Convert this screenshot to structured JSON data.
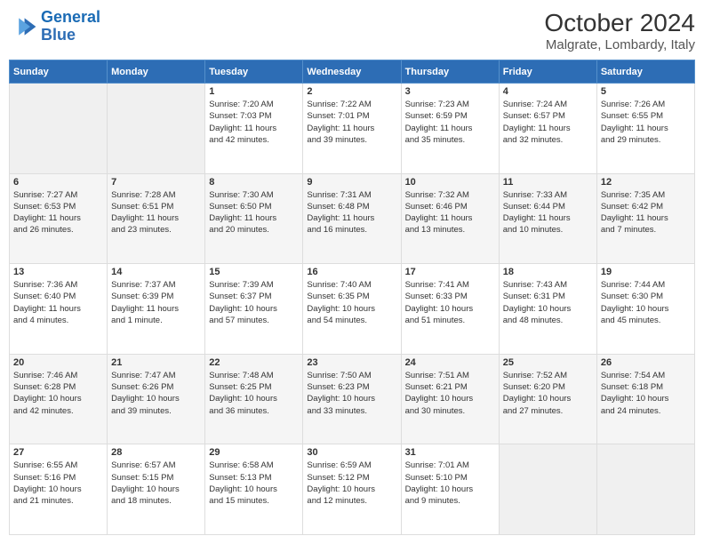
{
  "logo": {
    "line1": "General",
    "line2": "Blue"
  },
  "title": "October 2024",
  "subtitle": "Malgrate, Lombardy, Italy",
  "days_of_week": [
    "Sunday",
    "Monday",
    "Tuesday",
    "Wednesday",
    "Thursday",
    "Friday",
    "Saturday"
  ],
  "weeks": [
    [
      {
        "day": "",
        "info": ""
      },
      {
        "day": "",
        "info": ""
      },
      {
        "day": "1",
        "info": "Sunrise: 7:20 AM\nSunset: 7:03 PM\nDaylight: 11 hours\nand 42 minutes."
      },
      {
        "day": "2",
        "info": "Sunrise: 7:22 AM\nSunset: 7:01 PM\nDaylight: 11 hours\nand 39 minutes."
      },
      {
        "day": "3",
        "info": "Sunrise: 7:23 AM\nSunset: 6:59 PM\nDaylight: 11 hours\nand 35 minutes."
      },
      {
        "day": "4",
        "info": "Sunrise: 7:24 AM\nSunset: 6:57 PM\nDaylight: 11 hours\nand 32 minutes."
      },
      {
        "day": "5",
        "info": "Sunrise: 7:26 AM\nSunset: 6:55 PM\nDaylight: 11 hours\nand 29 minutes."
      }
    ],
    [
      {
        "day": "6",
        "info": "Sunrise: 7:27 AM\nSunset: 6:53 PM\nDaylight: 11 hours\nand 26 minutes."
      },
      {
        "day": "7",
        "info": "Sunrise: 7:28 AM\nSunset: 6:51 PM\nDaylight: 11 hours\nand 23 minutes."
      },
      {
        "day": "8",
        "info": "Sunrise: 7:30 AM\nSunset: 6:50 PM\nDaylight: 11 hours\nand 20 minutes."
      },
      {
        "day": "9",
        "info": "Sunrise: 7:31 AM\nSunset: 6:48 PM\nDaylight: 11 hours\nand 16 minutes."
      },
      {
        "day": "10",
        "info": "Sunrise: 7:32 AM\nSunset: 6:46 PM\nDaylight: 11 hours\nand 13 minutes."
      },
      {
        "day": "11",
        "info": "Sunrise: 7:33 AM\nSunset: 6:44 PM\nDaylight: 11 hours\nand 10 minutes."
      },
      {
        "day": "12",
        "info": "Sunrise: 7:35 AM\nSunset: 6:42 PM\nDaylight: 11 hours\nand 7 minutes."
      }
    ],
    [
      {
        "day": "13",
        "info": "Sunrise: 7:36 AM\nSunset: 6:40 PM\nDaylight: 11 hours\nand 4 minutes."
      },
      {
        "day": "14",
        "info": "Sunrise: 7:37 AM\nSunset: 6:39 PM\nDaylight: 11 hours\nand 1 minute."
      },
      {
        "day": "15",
        "info": "Sunrise: 7:39 AM\nSunset: 6:37 PM\nDaylight: 10 hours\nand 57 minutes."
      },
      {
        "day": "16",
        "info": "Sunrise: 7:40 AM\nSunset: 6:35 PM\nDaylight: 10 hours\nand 54 minutes."
      },
      {
        "day": "17",
        "info": "Sunrise: 7:41 AM\nSunset: 6:33 PM\nDaylight: 10 hours\nand 51 minutes."
      },
      {
        "day": "18",
        "info": "Sunrise: 7:43 AM\nSunset: 6:31 PM\nDaylight: 10 hours\nand 48 minutes."
      },
      {
        "day": "19",
        "info": "Sunrise: 7:44 AM\nSunset: 6:30 PM\nDaylight: 10 hours\nand 45 minutes."
      }
    ],
    [
      {
        "day": "20",
        "info": "Sunrise: 7:46 AM\nSunset: 6:28 PM\nDaylight: 10 hours\nand 42 minutes."
      },
      {
        "day": "21",
        "info": "Sunrise: 7:47 AM\nSunset: 6:26 PM\nDaylight: 10 hours\nand 39 minutes."
      },
      {
        "day": "22",
        "info": "Sunrise: 7:48 AM\nSunset: 6:25 PM\nDaylight: 10 hours\nand 36 minutes."
      },
      {
        "day": "23",
        "info": "Sunrise: 7:50 AM\nSunset: 6:23 PM\nDaylight: 10 hours\nand 33 minutes."
      },
      {
        "day": "24",
        "info": "Sunrise: 7:51 AM\nSunset: 6:21 PM\nDaylight: 10 hours\nand 30 minutes."
      },
      {
        "day": "25",
        "info": "Sunrise: 7:52 AM\nSunset: 6:20 PM\nDaylight: 10 hours\nand 27 minutes."
      },
      {
        "day": "26",
        "info": "Sunrise: 7:54 AM\nSunset: 6:18 PM\nDaylight: 10 hours\nand 24 minutes."
      }
    ],
    [
      {
        "day": "27",
        "info": "Sunrise: 6:55 AM\nSunset: 5:16 PM\nDaylight: 10 hours\nand 21 minutes."
      },
      {
        "day": "28",
        "info": "Sunrise: 6:57 AM\nSunset: 5:15 PM\nDaylight: 10 hours\nand 18 minutes."
      },
      {
        "day": "29",
        "info": "Sunrise: 6:58 AM\nSunset: 5:13 PM\nDaylight: 10 hours\nand 15 minutes."
      },
      {
        "day": "30",
        "info": "Sunrise: 6:59 AM\nSunset: 5:12 PM\nDaylight: 10 hours\nand 12 minutes."
      },
      {
        "day": "31",
        "info": "Sunrise: 7:01 AM\nSunset: 5:10 PM\nDaylight: 10 hours\nand 9 minutes."
      },
      {
        "day": "",
        "info": ""
      },
      {
        "day": "",
        "info": ""
      }
    ]
  ]
}
